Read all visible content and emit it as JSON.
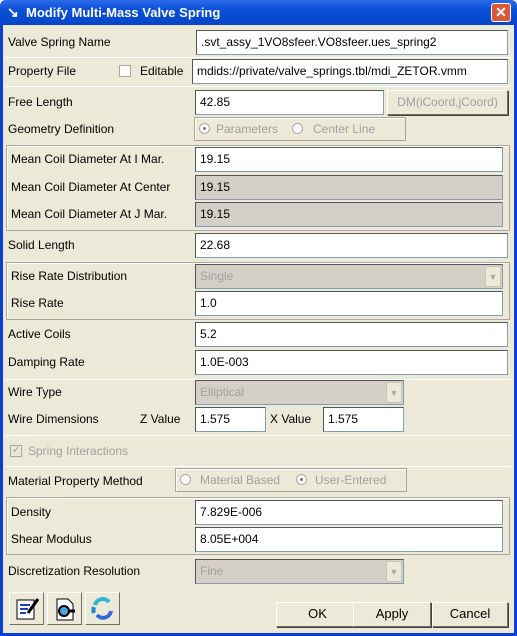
{
  "window": {
    "title": "Modify Multi-Mass Valve Spring"
  },
  "fields": {
    "valve_spring_name": {
      "label": "Valve Spring Name",
      "value": ".svt_assy_1VO8sfeer.VO8sfeer.ues_spring2"
    },
    "property_file": {
      "label": "Property File",
      "editable_label": "Editable",
      "editable_checked": false,
      "value": "mdids://private/valve_springs.tbl/mdi_ZETOR.vmm"
    },
    "free_length": {
      "label": "Free Length",
      "value": "42.85",
      "dm_button": "DM(iCoord,jCoord)"
    },
    "geometry_definition": {
      "label": "Geometry Definition",
      "options": [
        "Parameters",
        "Center Line"
      ],
      "selected": "Parameters"
    },
    "mean_coil_i": {
      "label": "Mean Coil Diameter At I Mar.",
      "value": "19.15"
    },
    "mean_coil_center": {
      "label": "Mean Coil Diameter At Center",
      "value": "19.15"
    },
    "mean_coil_j": {
      "label": "Mean Coil Diameter At J Mar.",
      "value": "19.15"
    },
    "solid_length": {
      "label": "Solid Length",
      "value": "22.68"
    },
    "rise_rate_distribution": {
      "label": "Rise Rate Distribution",
      "value": "Single"
    },
    "rise_rate": {
      "label": "Rise Rate",
      "value": "1.0"
    },
    "active_coils": {
      "label": "Active Coils",
      "value": "5.2"
    },
    "damping_rate": {
      "label": "Damping Rate",
      "value": "1.0E-003"
    },
    "wire_type": {
      "label": "Wire Type",
      "value": "Elliptical"
    },
    "wire_dimensions": {
      "label": "Wire Dimensions",
      "z_label": "Z Value",
      "z_value": "1.575",
      "x_label": "X Value",
      "x_value": "1.575"
    },
    "spring_interactions": {
      "label": "Spring Interactions",
      "checked": true
    },
    "material_property_method": {
      "label": "Material Property Method",
      "options": [
        "Material Based",
        "User-Entered"
      ],
      "selected": "User-Entered"
    },
    "density": {
      "label": "Density",
      "value": "7.829E-006"
    },
    "shear_modulus": {
      "label": "Shear Modulus",
      "value": "8.05E+004"
    },
    "discretization_resolution": {
      "label": "Discretization Resolution",
      "value": "Fine"
    }
  },
  "buttons": {
    "ok": "OK",
    "apply": "Apply",
    "cancel": "Cancel"
  },
  "tool_icons": [
    "edit-notes-icon",
    "file-search-icon",
    "refresh-icon"
  ]
}
